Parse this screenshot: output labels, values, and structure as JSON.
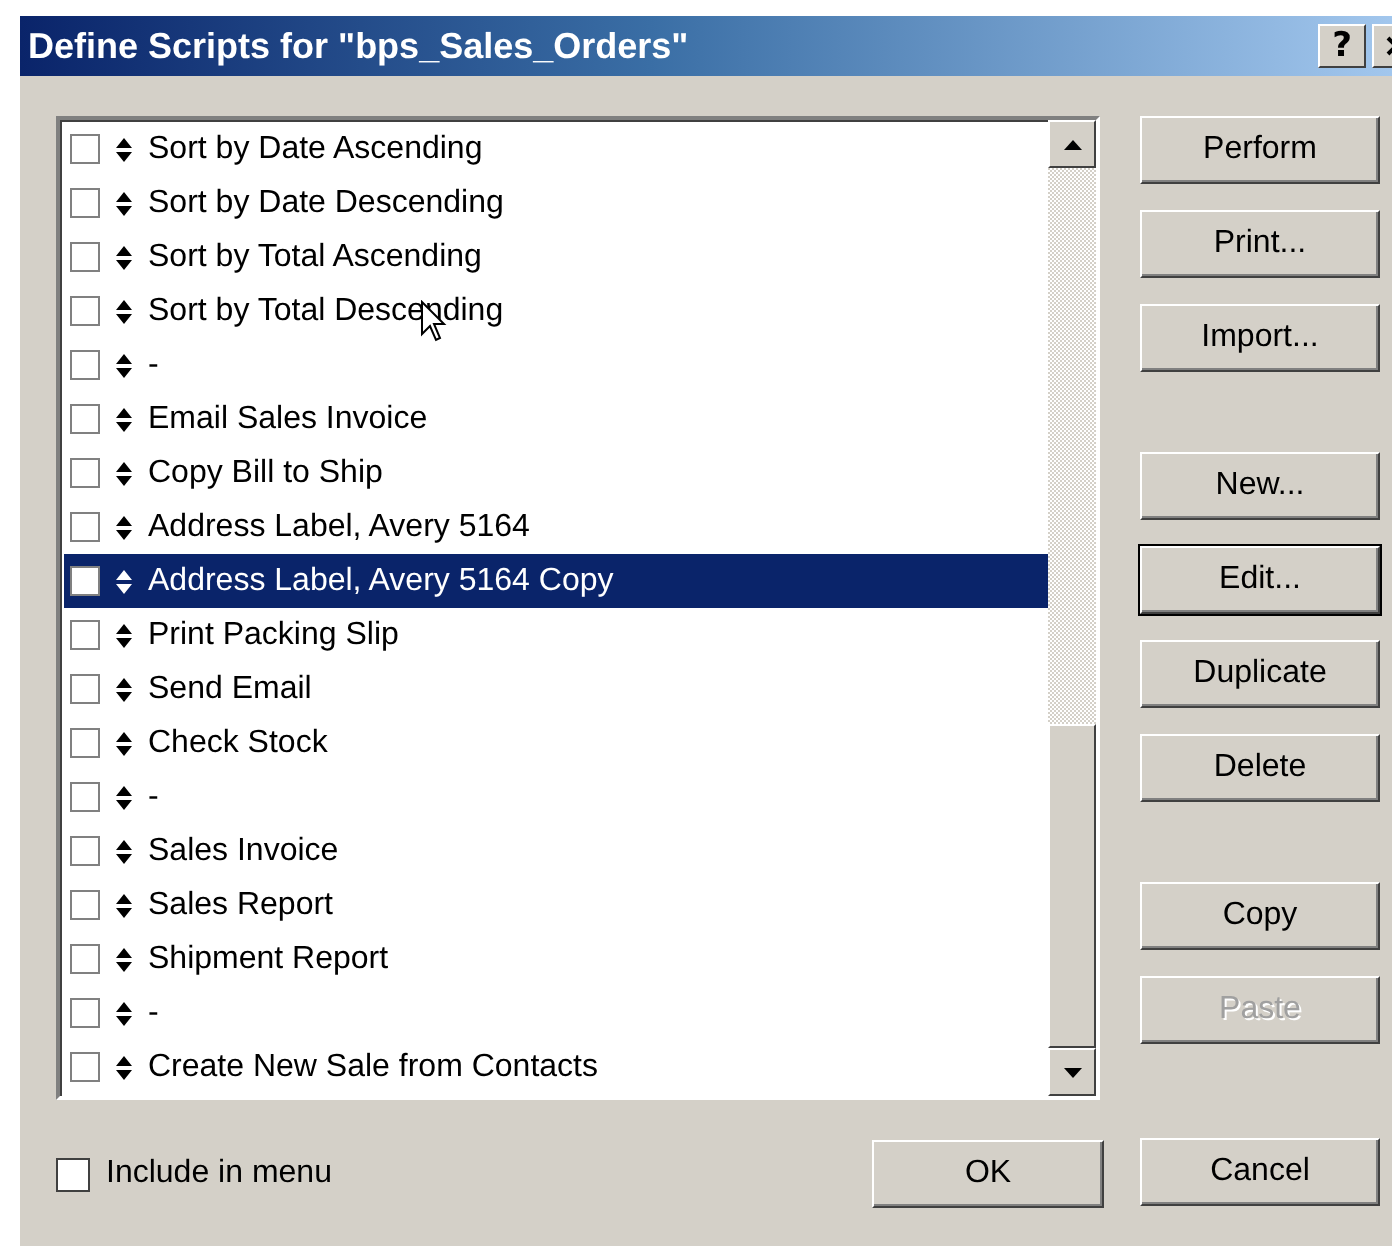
{
  "window": {
    "title": "Define Scripts for \"bps_Sales_Orders\"",
    "title_buttons": [
      {
        "kind": "help",
        "label": "?"
      }
    ]
  },
  "scripts": [
    {
      "name": "Sort by Date Ascending",
      "checked": false,
      "selected": false
    },
    {
      "name": "Sort by Date Descending",
      "checked": false,
      "selected": false
    },
    {
      "name": "Sort by Total Ascending",
      "checked": false,
      "selected": false
    },
    {
      "name": "Sort by Total Descending",
      "checked": false,
      "selected": false
    },
    {
      "name": "-",
      "checked": false,
      "selected": false
    },
    {
      "name": "Email Sales Invoice",
      "checked": false,
      "selected": false
    },
    {
      "name": "Copy Bill to Ship",
      "checked": false,
      "selected": false
    },
    {
      "name": "Address Label, Avery 5164",
      "checked": false,
      "selected": false
    },
    {
      "name": "Address Label, Avery 5164 Copy",
      "checked": false,
      "selected": true
    },
    {
      "name": "Print Packing Slip",
      "checked": false,
      "selected": false
    },
    {
      "name": "Send Email",
      "checked": false,
      "selected": false
    },
    {
      "name": "Check Stock",
      "checked": false,
      "selected": false
    },
    {
      "name": "-",
      "checked": false,
      "selected": false
    },
    {
      "name": "Sales Invoice",
      "checked": false,
      "selected": false
    },
    {
      "name": "Sales Report",
      "checked": false,
      "selected": false
    },
    {
      "name": "Shipment Report",
      "checked": false,
      "selected": false
    },
    {
      "name": "-",
      "checked": false,
      "selected": false
    },
    {
      "name": "Create New Sale from Contacts",
      "checked": false,
      "selected": false
    }
  ],
  "button_groups": [
    [
      {
        "label": "Perform",
        "default": false,
        "disabled": false
      },
      {
        "label": "Print...",
        "default": false,
        "disabled": false
      },
      {
        "label": "Import...",
        "default": false,
        "disabled": false
      }
    ],
    [
      {
        "label": "New...",
        "default": false,
        "disabled": false
      },
      {
        "label": "Edit...",
        "default": true,
        "disabled": false
      },
      {
        "label": "Duplicate",
        "default": false,
        "disabled": false
      },
      {
        "label": "Delete",
        "default": false,
        "disabled": false
      }
    ],
    [
      {
        "label": "Copy",
        "default": false,
        "disabled": false
      },
      {
        "label": "Paste",
        "default": false,
        "disabled": true
      }
    ]
  ],
  "include_in_menu": {
    "label": "Include in menu",
    "checked": false
  },
  "footer_buttons": [
    {
      "label": "OK"
    },
    {
      "label": "Cancel"
    }
  ]
}
